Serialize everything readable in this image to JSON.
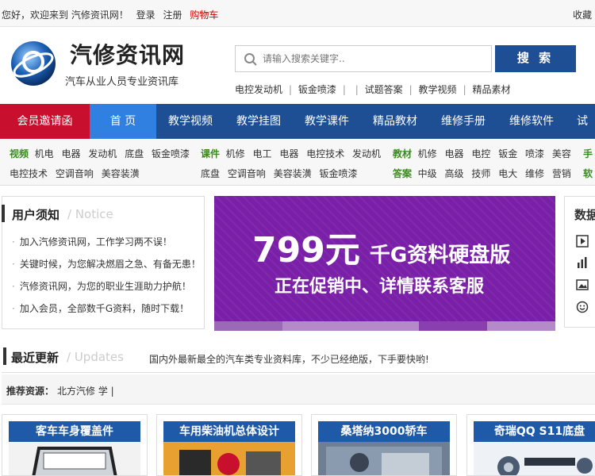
{
  "topbar": {
    "greeting": "您好，欢迎来到 汽修资讯网！",
    "login": "登录",
    "register": "注册",
    "cart": "购物车",
    "favorite": "收藏"
  },
  "header": {
    "logo_title": "汽修资讯网",
    "logo_subtitle": "汽车从业人员专业资讯库",
    "search_placeholder": "请输入搜索关键字..",
    "search_button": "搜 索",
    "hot_links": [
      "电控发动机",
      "钣金喷漆",
      "",
      "试题答案",
      "教学视频",
      "精品素材"
    ]
  },
  "nav": {
    "items": [
      "会员邀请函",
      "首 页",
      "教学视频",
      "教学挂图",
      "教学课件",
      "精品教材",
      "维修手册",
      "维修软件",
      "试题"
    ]
  },
  "categories": {
    "video": {
      "label": "视频",
      "row1": [
        "机电",
        "电器",
        "发动机",
        "底盘",
        "钣金喷漆"
      ],
      "row2": [
        "电控技术",
        "空调音响",
        "美容装潢"
      ]
    },
    "courseware": {
      "label": "课件",
      "row1": [
        "机修",
        "电工",
        "电器",
        "电控技术",
        "发动机"
      ],
      "row2": [
        "底盘",
        "空调音响",
        "美容装潢",
        "钣金喷漆"
      ]
    },
    "textbook": {
      "label": "教材",
      "row1": [
        "机修",
        "电器",
        "电控",
        "钣金",
        "喷漆",
        "美容"
      ]
    },
    "answers": {
      "label": "答案",
      "row1": [
        "中级",
        "高级",
        "技师",
        "电大",
        "维修",
        "营销"
      ]
    },
    "extra": {
      "row1": "手",
      "row2": "软"
    }
  },
  "notice": {
    "title": "用户须知",
    "title_en": "/ Notice",
    "items": [
      "加入汽修资讯网，工作学习两不误！",
      "关键时候，为您解决燃眉之急、有备无患！",
      "汽修资讯网，为您的职业生涯助力护航！",
      "加入会员，全部数千G资料，随时下载！"
    ]
  },
  "banner": {
    "price": "799元",
    "product": "千G资料硬盘版",
    "line2": "正在促销中、详情联系客服"
  },
  "right_panel": {
    "title": "数据"
  },
  "updates": {
    "title": "最近更新",
    "title_en": "/ Updates",
    "desc": "国内外最新最全的汽车类专业资料库，不少已经绝版，下手要快哟!"
  },
  "recommend": {
    "label": "推荐资源：",
    "value": "北方汽修 学 |"
  },
  "cards": [
    {
      "title": "客车车身覆盖件"
    },
    {
      "title": "车用柴油机总体设计"
    },
    {
      "title": "桑塔纳3000轿车"
    },
    {
      "title": "奇瑞QQ S11底盘"
    }
  ],
  "colors": {
    "nav_bg": "#1e4f94",
    "invite_bg": "#c8102e",
    "active_bg": "#2f80e0",
    "banner_bg": "#7a1fa8",
    "category_label": "#3b8a20"
  }
}
